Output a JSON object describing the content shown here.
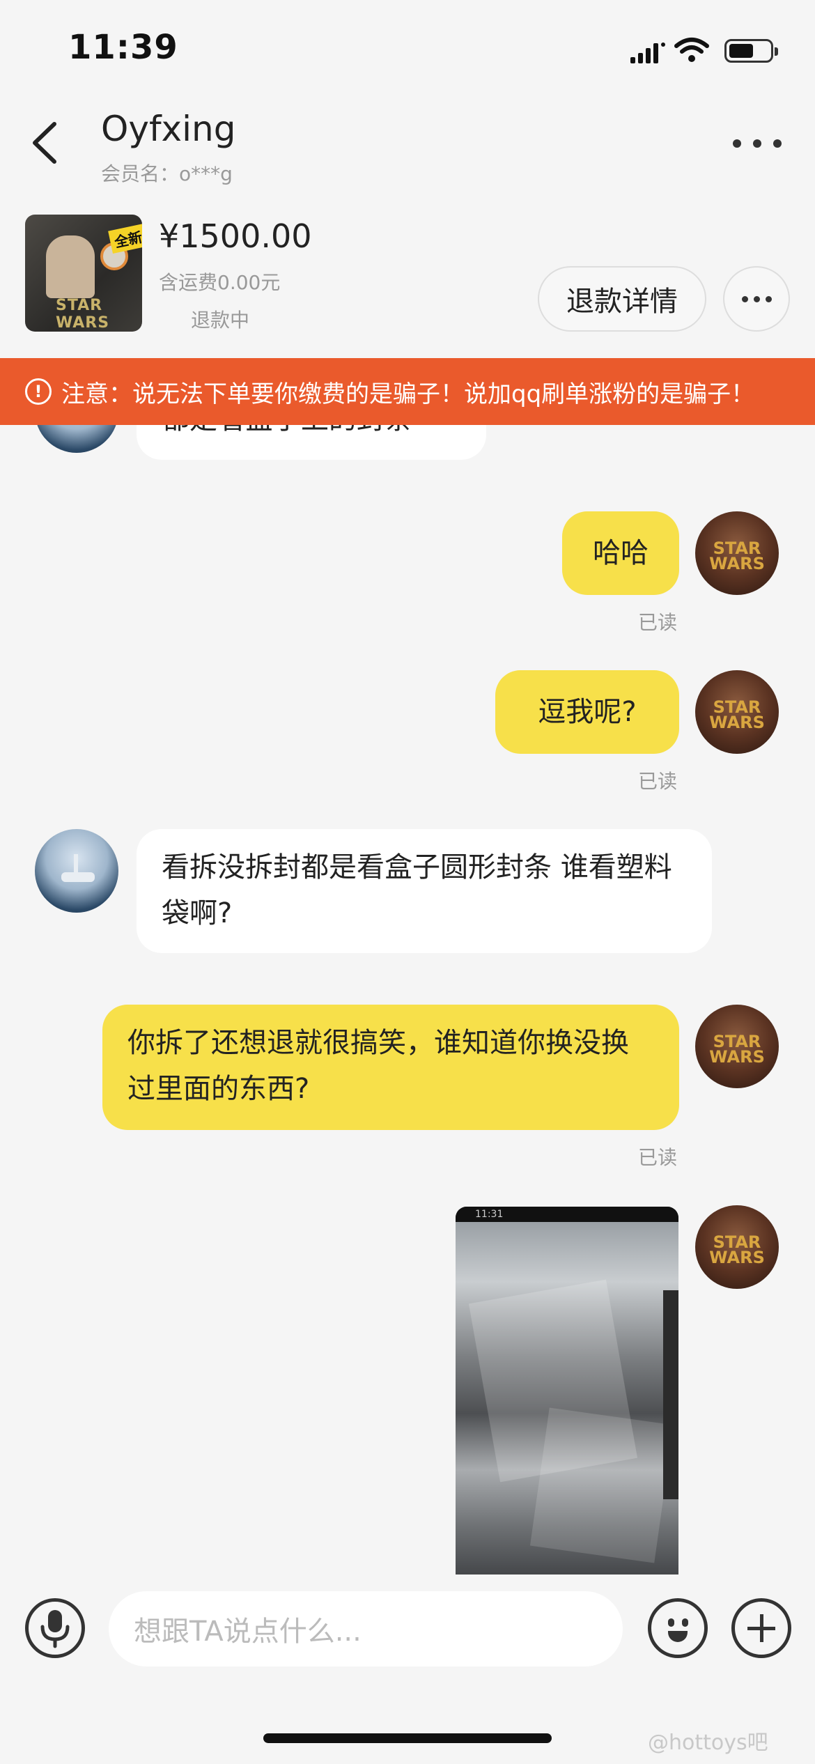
{
  "status_bar": {
    "time": "11:39"
  },
  "header": {
    "title": "Oyfxing",
    "subtitle": "会员名：o***g"
  },
  "product": {
    "thumb_tag": "全新",
    "thumb_text": "STAR WARS",
    "price": "¥1500.00",
    "shipping": "含运费0.00元",
    "status": "退款中",
    "refund_button": "退款详情"
  },
  "warning": {
    "icon": "!",
    "text": "注意：说无法下单要你缴费的是骗子！说加qq刷单涨粉的是骗子！"
  },
  "messages": [
    {
      "from": "other",
      "text": "都是看盒子上的封条"
    },
    {
      "from": "me",
      "text": "哈哈",
      "read": "已读"
    },
    {
      "from": "me",
      "text": "逗我呢?",
      "read": "已读"
    },
    {
      "from": "other",
      "text": "看拆没拆封都是看盒子圆形封条  谁看塑料袋啊?"
    },
    {
      "from": "me",
      "text": "你拆了还想退就很搞笑，谁知道你换没换过里面的东西?",
      "read": "已读"
    },
    {
      "from": "me",
      "type": "image",
      "photo_time": "11:31"
    }
  ],
  "avatars": {
    "me_text": "STAR WARS"
  },
  "input": {
    "placeholder": "想跟TA说点什么..."
  },
  "watermark": "@hottoys吧",
  "colors": {
    "warning_bg": "#ea5a2c",
    "my_bubble": "#f7e04a",
    "background": "#f5f5f5"
  },
  "icons": [
    "back-arrow-icon",
    "more-icon",
    "signal-icon",
    "wifi-icon",
    "battery-icon",
    "microphone-icon",
    "emoji-icon",
    "plus-icon",
    "warning-icon"
  ]
}
